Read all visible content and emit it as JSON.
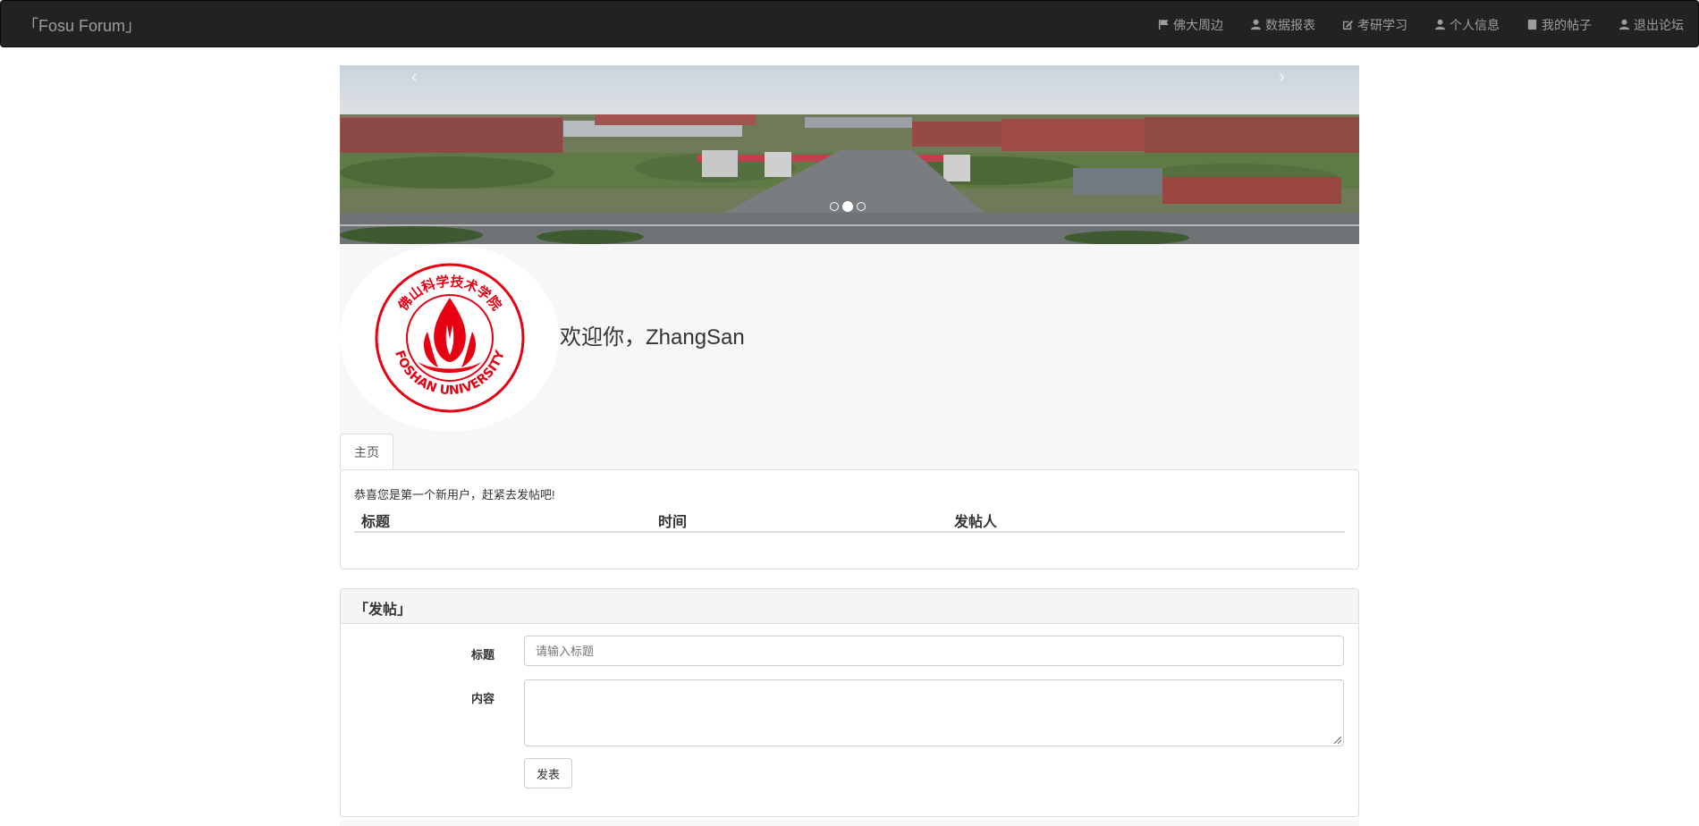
{
  "navbar": {
    "brand": "「Fosu Forum」",
    "items": [
      {
        "label": "佛大周边",
        "icon": "flag-icon"
      },
      {
        "label": "数据报表",
        "icon": "user-icon"
      },
      {
        "label": "考研学习",
        "icon": "edit-icon"
      },
      {
        "label": "个人信息",
        "icon": "user-icon"
      },
      {
        "label": "我的帖子",
        "icon": "book-icon"
      },
      {
        "label": "退出论坛",
        "icon": "user-icon"
      }
    ]
  },
  "carousel": {
    "prev": "‹",
    "next": "›",
    "slide_count": 3,
    "active_index": 1
  },
  "jumbotron": {
    "logo_text_top": "佛山科学技术学院",
    "logo_text_bottom": "FOSHAN UNIVERSITY",
    "welcome": "欢迎你，ZhangSan",
    "tab_home": "主页"
  },
  "posts": {
    "notice": "恭喜您是第一个新用户，赶紧去发帖吧!",
    "columns": [
      "标题",
      "时间",
      "发帖人"
    ],
    "rows": []
  },
  "form": {
    "heading": "「发帖」",
    "title_label": "标题",
    "title_placeholder": "请输入标题",
    "content_label": "内容",
    "submit": "发表"
  },
  "colors": {
    "navbar_bg": "#222222",
    "logo_red": "#e60012"
  }
}
